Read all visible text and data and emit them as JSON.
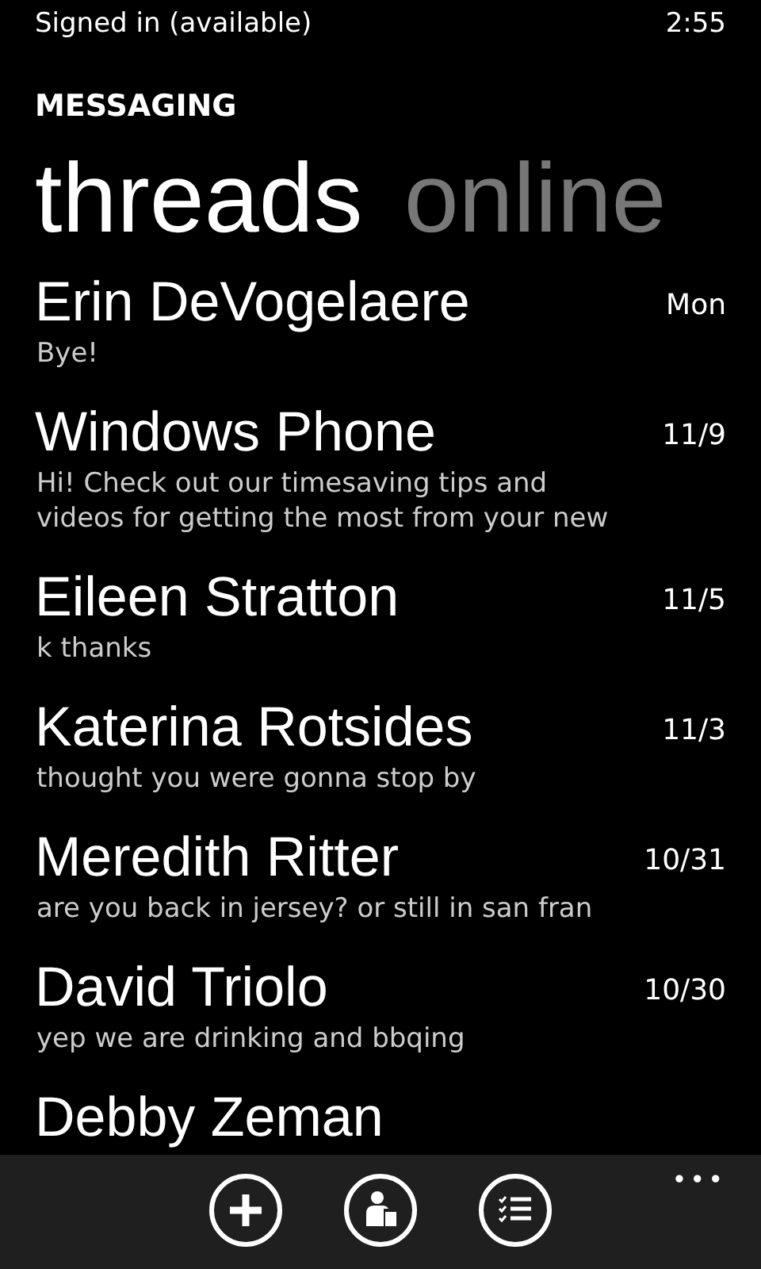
{
  "status_bar": {
    "presence": "Signed in (available)",
    "time": "2:55"
  },
  "app_title": "MESSAGING",
  "pivot_tabs": [
    {
      "label": "threads",
      "selected": true
    },
    {
      "label": "online",
      "selected": false
    }
  ],
  "threads": [
    {
      "name": "Erin DeVogelaere",
      "preview": "Bye!",
      "date": "Mon"
    },
    {
      "name": "Windows Phone",
      "preview": "Hi! Check out our timesaving tips and videos for getting the most from your new",
      "date": "11/9"
    },
    {
      "name": "Eileen Stratton",
      "preview": "k thanks",
      "date": "11/5"
    },
    {
      "name": "Katerina Rotsides",
      "preview": "thought you were gonna stop by",
      "date": "11/3"
    },
    {
      "name": "Meredith Ritter",
      "preview": "are you back in jersey?  or still in san fran",
      "date": "10/31"
    },
    {
      "name": "David Triolo",
      "preview": "yep we are drinking and bbqing",
      "date": "10/30"
    },
    {
      "name": "Debby Zeman"
    }
  ],
  "app_bar": {
    "buttons": [
      {
        "kind": "new"
      },
      {
        "kind": "contact"
      },
      {
        "kind": "select"
      }
    ],
    "more": "•••"
  }
}
